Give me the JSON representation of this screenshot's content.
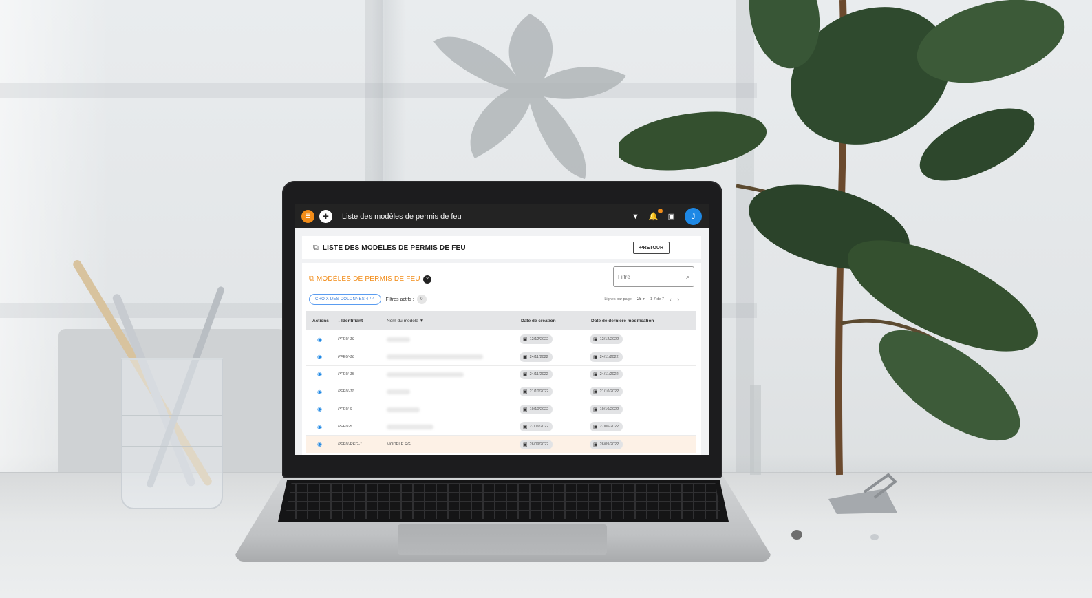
{
  "app": {
    "title": "Liste des modèles de permis de feu",
    "user_initial": "J"
  },
  "header": {
    "title": "LISTE DES MODÈLES DE PERMIS DE FEU",
    "back_label": "↩RETOUR"
  },
  "list": {
    "title": "MODÈLES DE PERMIS DE FEU",
    "help": "?",
    "filter_placeholder": "Filtre",
    "columns_chip": "CHOIX DES COLONNES 4 / 4",
    "filters_label": "Filtres actifs :",
    "filters_count": "0",
    "rows_per_page_label": "Lignes par page",
    "rows_per_page": "25",
    "page_range": "1-7 de 7",
    "columns": {
      "actions": "Actions",
      "id": "↓ Identifiant",
      "name": "Nom du modèle",
      "created": "Date de création",
      "modified": "Date de dernière modification"
    },
    "rows": [
      {
        "id": "PFEU-19",
        "name": "",
        "created": "12/12/2022",
        "modified": "12/12/2022"
      },
      {
        "id": "PFEU-16",
        "name": "",
        "created": "24/11/2022",
        "modified": "24/11/2022"
      },
      {
        "id": "PFEU-15",
        "name": "",
        "created": "24/11/2022",
        "modified": "24/11/2022"
      },
      {
        "id": "PFEU-11",
        "name": "",
        "created": "21/10/2022",
        "modified": "21/10/2022"
      },
      {
        "id": "PFEU-9",
        "name": "",
        "created": "19/10/2022",
        "modified": "19/10/2022"
      },
      {
        "id": "PFEU-5",
        "name": "",
        "created": "27/06/2022",
        "modified": "27/06/2022"
      },
      {
        "id": "PFEU-REG-1",
        "name": "MODÈLE RG",
        "created": "26/09/2022",
        "modified": "26/09/2022"
      }
    ]
  },
  "colors": {
    "accent": "#f28c18",
    "topbar": "#232323",
    "avatar": "#1e88e5",
    "link": "#1e88e5",
    "highlight_row": "#fdf1e6"
  },
  "icons": {
    "menu": "menu-icon",
    "add": "plus-icon",
    "filter": "filter-icon",
    "notifications": "bell-icon",
    "calendar": "calendar-icon",
    "view": "eye-icon",
    "search": "search-icon",
    "copy": "copy-icon",
    "prev": "chevron-left-icon",
    "next": "chevron-right-icon"
  }
}
